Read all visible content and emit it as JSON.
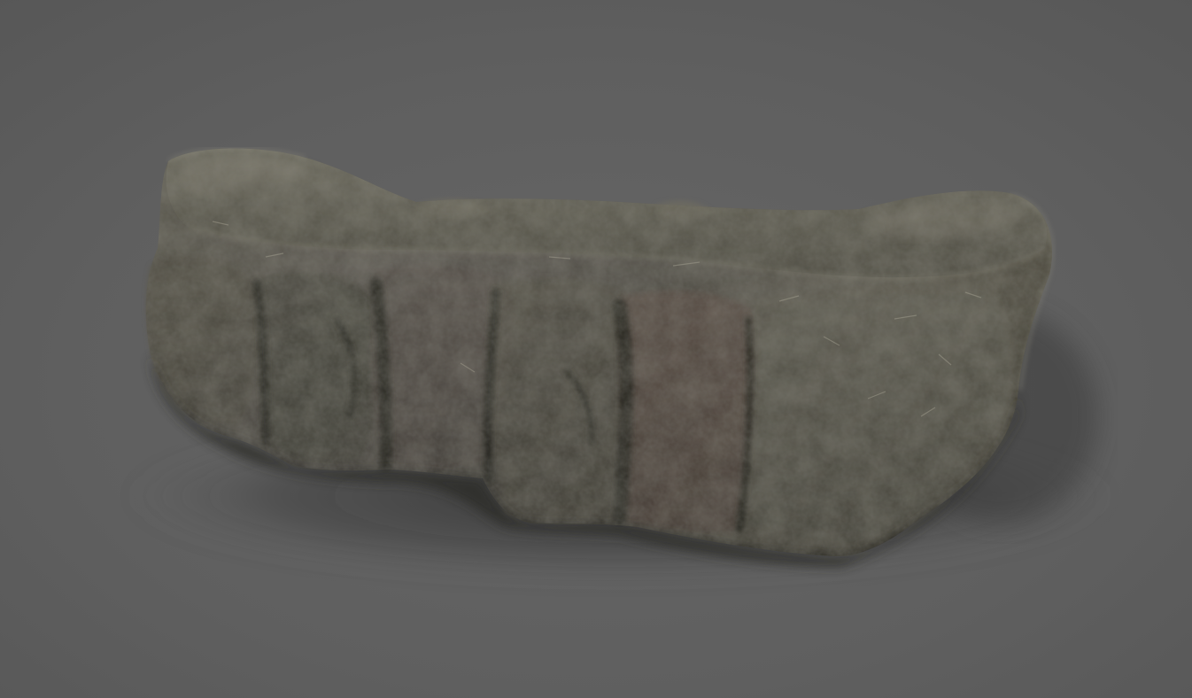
{
  "scene": {
    "subject_icon": "rock-icon",
    "colors": {
      "background_top": "#595959",
      "background_center": "#636363",
      "background_bottom": "#5b5b5b",
      "rock_light": "#7a786a",
      "rock_mid": "#625f52",
      "rock_dark": "#3f3d35",
      "rock_shadow": "#2d2c27",
      "rock_warm": "#6e6156",
      "ground_shadow": "#3a3a3a"
    }
  }
}
